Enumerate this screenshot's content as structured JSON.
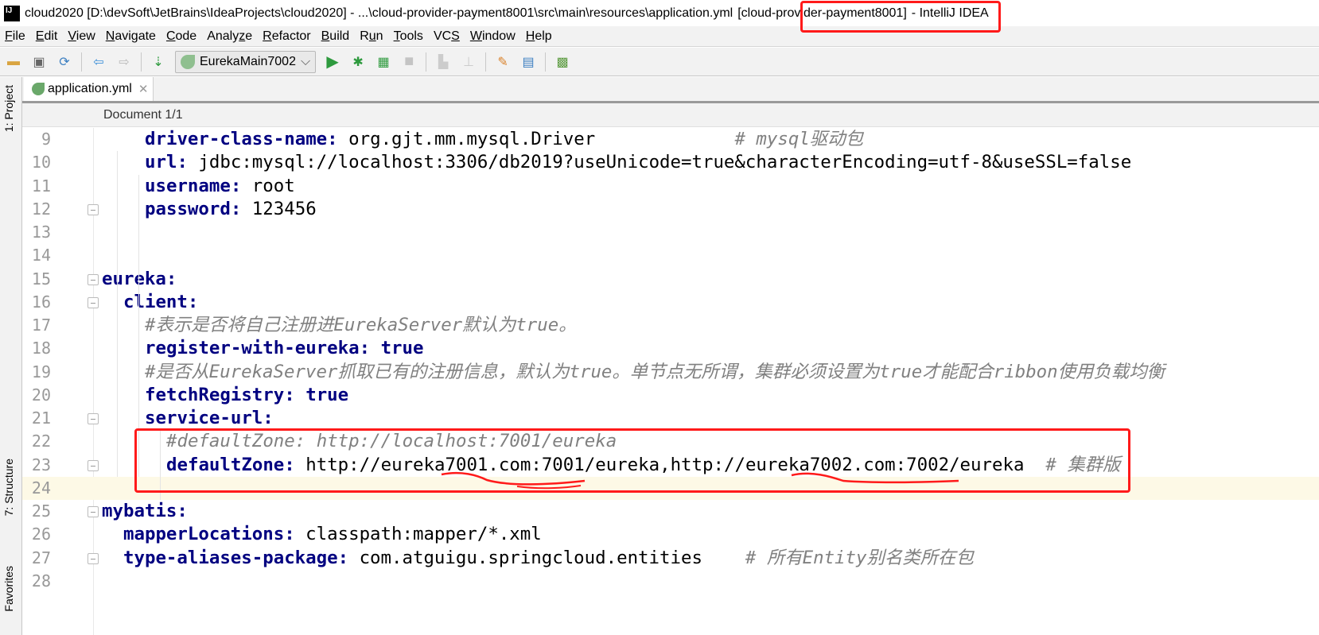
{
  "window": {
    "title_main": "cloud2020 [D:\\devSoft\\JetBrains\\IdeaProjects\\cloud2020] - ...\\cloud-provider-payment8001\\src\\main\\resources\\application.yml",
    "title_module": "[cloud-provider-payment8001]",
    "title_app": "- IntelliJ IDEA",
    "logo_text": "IJ"
  },
  "menu": [
    {
      "u": "F",
      "rest": "ile"
    },
    {
      "u": "E",
      "rest": "dit"
    },
    {
      "u": "V",
      "rest": "iew"
    },
    {
      "u": "N",
      "rest": "avigate"
    },
    {
      "u": "C",
      "rest": "ode"
    },
    {
      "pre": "Analy",
      "u": "z",
      "rest": "e"
    },
    {
      "u": "R",
      "rest": "efactor"
    },
    {
      "u": "B",
      "rest": "uild"
    },
    {
      "pre": "R",
      "u": "u",
      "rest": "n"
    },
    {
      "u": "T",
      "rest": "ools"
    },
    {
      "pre": "VC",
      "u": "S",
      "rest": ""
    },
    {
      "u": "W",
      "rest": "indow"
    },
    {
      "u": "H",
      "rest": "elp"
    }
  ],
  "toolbar": {
    "run_config": "EurekaMain7002"
  },
  "side_tabs": {
    "project": "1: Project",
    "structure": "7: Structure",
    "favorites": "Favorites"
  },
  "editor": {
    "tab_label": "application.yml",
    "breadcrumb": "Document 1/1",
    "current_line": 24,
    "lines": [
      {
        "n": 9,
        "ind": 4,
        "seg": [
          [
            "k",
            "driver-class-name:"
          ],
          [
            "v",
            " org.gjt.mm.mysql.Driver             "
          ],
          [
            "c",
            "# mysql驱动包"
          ]
        ]
      },
      {
        "n": 10,
        "ind": 4,
        "seg": [
          [
            "k",
            "url:"
          ],
          [
            "v",
            " jdbc:mysql://localhost:3306/db2019?useUnicode=true&characterEncoding=utf-8&useSSL=false"
          ]
        ]
      },
      {
        "n": 11,
        "ind": 4,
        "seg": [
          [
            "k",
            "username:"
          ],
          [
            "v",
            " root"
          ]
        ]
      },
      {
        "n": 12,
        "ind": 4,
        "fold": true,
        "seg": [
          [
            "k",
            "password:"
          ],
          [
            "v",
            " 123456"
          ]
        ]
      },
      {
        "n": 13,
        "ind": 0,
        "seg": []
      },
      {
        "n": 14,
        "ind": 0,
        "seg": []
      },
      {
        "n": 15,
        "ind": 0,
        "fold": true,
        "seg": [
          [
            "k",
            "eureka:"
          ]
        ]
      },
      {
        "n": 16,
        "ind": 2,
        "fold": true,
        "seg": [
          [
            "k",
            "client:"
          ]
        ]
      },
      {
        "n": 17,
        "ind": 4,
        "seg": [
          [
            "c",
            "#表示是否将自己注册进EurekaServer默认为true。"
          ]
        ]
      },
      {
        "n": 18,
        "ind": 4,
        "seg": [
          [
            "k",
            "register-with-eureka:"
          ],
          [
            "v",
            " "
          ],
          [
            "kw",
            "true"
          ]
        ]
      },
      {
        "n": 19,
        "ind": 4,
        "seg": [
          [
            "c",
            "#是否从EurekaServer抓取已有的注册信息，默认为true。单节点无所谓，集群必须设置为true才能配合ribbon使用负载均衡"
          ]
        ]
      },
      {
        "n": 20,
        "ind": 4,
        "seg": [
          [
            "k",
            "fetchRegistry:"
          ],
          [
            "v",
            " "
          ],
          [
            "kw",
            "true"
          ]
        ]
      },
      {
        "n": 21,
        "ind": 4,
        "fold": true,
        "seg": [
          [
            "k",
            "service-url:"
          ]
        ]
      },
      {
        "n": 22,
        "ind": 6,
        "seg": [
          [
            "c",
            "#defaultZone: http://localhost:7001/eureka"
          ]
        ]
      },
      {
        "n": 23,
        "ind": 6,
        "fold": true,
        "seg": [
          [
            "k",
            "defaultZone:"
          ],
          [
            "v",
            " http://eureka7001.com:7001/eureka,http://eureka7002.com:7002/eureka  "
          ],
          [
            "c",
            "# 集群版"
          ]
        ]
      },
      {
        "n": 24,
        "ind": 0,
        "seg": []
      },
      {
        "n": 25,
        "ind": 0,
        "fold": true,
        "seg": [
          [
            "k",
            "mybatis:"
          ]
        ]
      },
      {
        "n": 26,
        "ind": 2,
        "seg": [
          [
            "k",
            "mapperLocations:"
          ],
          [
            "v",
            " classpath:mapper/*.xml"
          ]
        ]
      },
      {
        "n": 27,
        "ind": 2,
        "fold": true,
        "seg": [
          [
            "k",
            "type-aliases-package:"
          ],
          [
            "v",
            " com.atguigu.springcloud.entities    "
          ],
          [
            "c",
            "# 所有Entity别名类所在包"
          ]
        ]
      },
      {
        "n": 28,
        "ind": 0,
        "seg": []
      }
    ]
  },
  "annotation_color": "#ff1a1a"
}
